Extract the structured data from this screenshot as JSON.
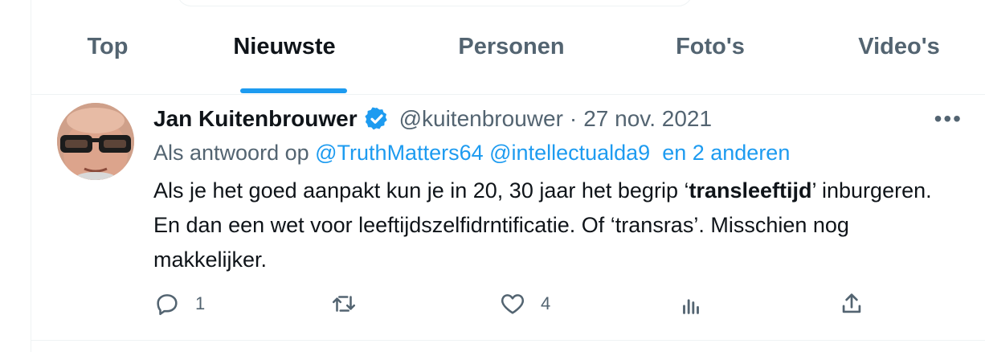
{
  "tabs": [
    {
      "label": "Top",
      "active": false
    },
    {
      "label": "Nieuwste",
      "active": true
    },
    {
      "label": "Personen",
      "active": false
    },
    {
      "label": "Foto's",
      "active": false
    },
    {
      "label": "Video's",
      "active": false
    }
  ],
  "tweet": {
    "author_name": "Jan Kuitenbrouwer",
    "handle": "@kuitenbrouwer",
    "separator": "·",
    "date": "27 nov. 2021",
    "reply_prefix": "Als antwoord op",
    "reply_to": [
      "@TruthMatters64",
      "@intellectualda9",
      "en 2 anderen"
    ],
    "text_part1": "Als je het goed aanpakt kun je in 20, 30 jaar het begrip ‘",
    "text_bold": "transleeftijd",
    "text_part2": "’ inburgeren. En dan een wet voor leeftijdszelfidrntificatie. Of ‘transras’. Misschien nog makkelijker.",
    "more_label": "•••",
    "reply_count": "1",
    "like_count": "4"
  },
  "colors": {
    "accent": "#1d9bf0",
    "secondary_text": "#536471",
    "primary_text": "#0f1419",
    "border": "#eff3f4"
  },
  "icons": [
    "verified-badge-icon",
    "more-icon",
    "reply-icon",
    "retweet-icon",
    "like-icon",
    "analytics-icon",
    "share-icon"
  ]
}
